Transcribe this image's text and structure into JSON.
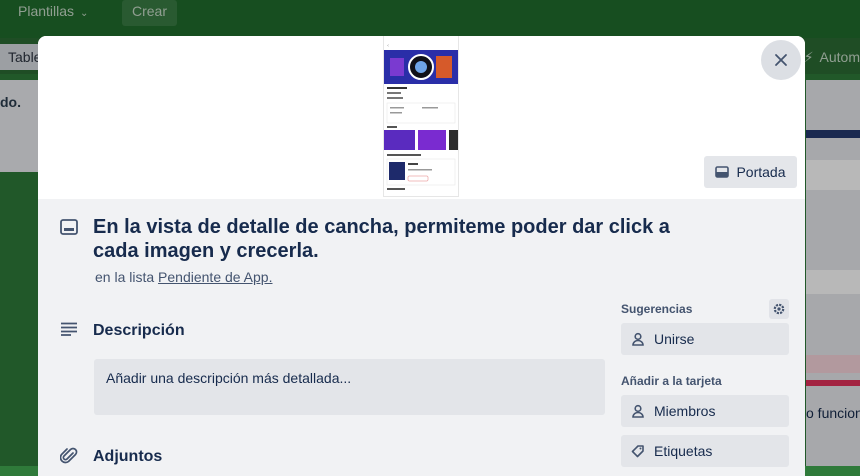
{
  "topbar": {
    "templates_label": "Plantillas",
    "create_label": "Crear"
  },
  "boardbar": {
    "left_item": "Table",
    "right_item": "Autom"
  },
  "background": {
    "left_list_text": "do.",
    "right_text": "o funcion"
  },
  "card": {
    "title": "En la vista de detalle de cancha, permiteme poder dar click a cada imagen y crecerla.",
    "list_prefix": "en la lista",
    "list_name": "Pendiente de App.",
    "cover_button": "Portada",
    "description": {
      "heading": "Descripción",
      "placeholder": "Añadir una descripción más detallada..."
    },
    "attachments": {
      "heading": "Adjuntos"
    }
  },
  "sidebar": {
    "suggestions": {
      "label": "Sugerencias",
      "join_button": "Unirse"
    },
    "add_to_card": {
      "label": "Añadir a la tarjeta",
      "members_button": "Miembros",
      "labels_button": "Etiquetas"
    }
  },
  "colors": {
    "board_bg": "#2f7a3a",
    "modal_bg": "#f1f2f4",
    "text": "#172b4d"
  }
}
